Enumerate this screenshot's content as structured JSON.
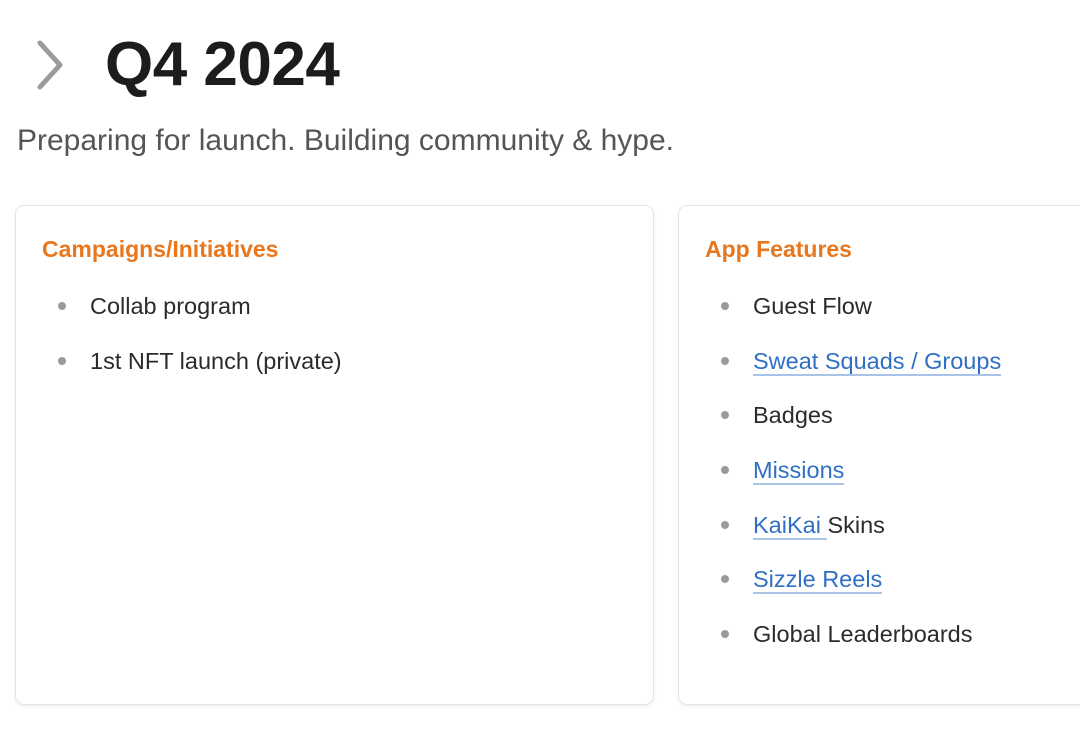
{
  "header": {
    "toggle_icon": "chevron-right-icon",
    "title": "Q4 2024",
    "subtitle": "Preparing for launch. Building community & hype."
  },
  "colors": {
    "heading_accent": "#e8771e",
    "link": "#2f6fc4",
    "bullet": "#9a9a9a"
  },
  "cards": [
    {
      "heading": "Campaigns/Initiatives",
      "items": [
        {
          "text": "Collab program"
        },
        {
          "text": "1st NFT launch (private)"
        }
      ]
    },
    {
      "heading": "App Features",
      "items": [
        {
          "text": "Guest Flow"
        },
        {
          "link": "Sweat Squads / Groups"
        },
        {
          "text": "Badges"
        },
        {
          "link": "Missions"
        },
        {
          "link": "KaiKai ",
          "text": "Skins"
        },
        {
          "link": "Sizzle Reels"
        },
        {
          "text": "Global Leaderboards"
        }
      ]
    }
  ]
}
